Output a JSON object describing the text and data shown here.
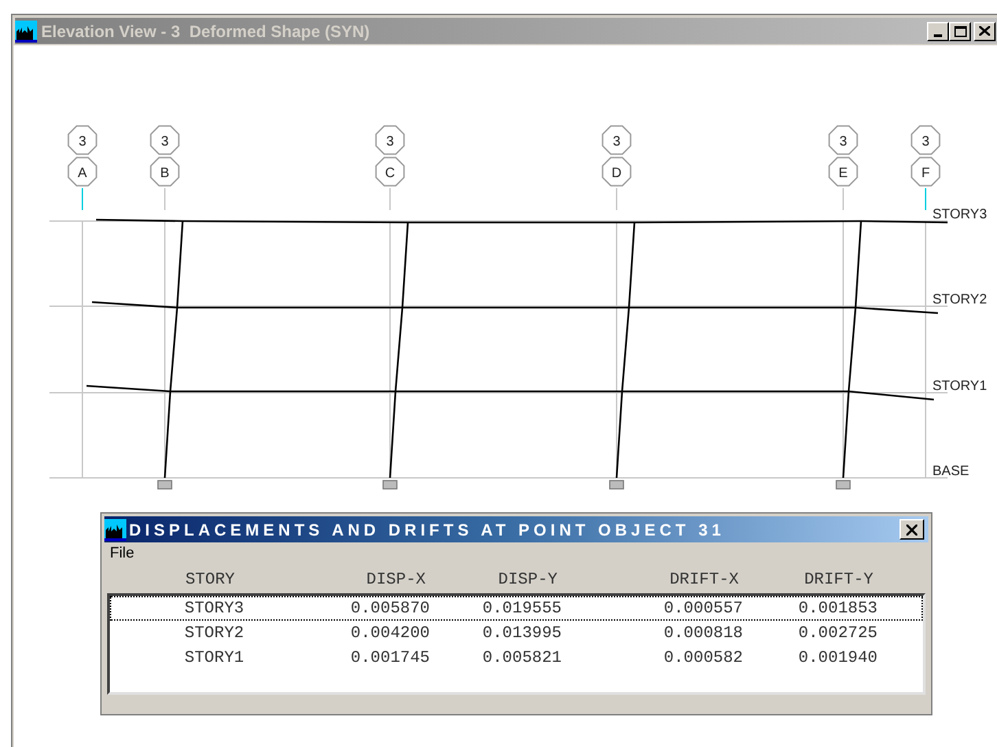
{
  "window": {
    "title": "Elevation View - 3  Deformed Shape (SYN)"
  },
  "elevation": {
    "grid_bubbles": [
      {
        "number": "3",
        "label": "A"
      },
      {
        "number": "3",
        "label": "B"
      },
      {
        "number": "3",
        "label": "C"
      },
      {
        "number": "3",
        "label": "D"
      },
      {
        "number": "3",
        "label": "E"
      },
      {
        "number": "3",
        "label": "F"
      }
    ],
    "story_levels": [
      "STORY3",
      "STORY2",
      "STORY1",
      "BASE"
    ]
  },
  "dialog": {
    "title": "DISPLACEMENTS AND DRIFTS AT POINT OBJECT 31",
    "menu": [
      "File"
    ],
    "columns": [
      "STORY",
      "DISP-X",
      "DISP-Y",
      "DRIFT-X",
      "DRIFT-Y"
    ],
    "rows": [
      {
        "cells": [
          "STORY3",
          "0.005870",
          "0.019555",
          "0.000557",
          "0.001853"
        ],
        "selected": true
      },
      {
        "cells": [
          "STORY2",
          "0.004200",
          "0.013995",
          "0.000818",
          "0.002725"
        ],
        "selected": false
      },
      {
        "cells": [
          "STORY1",
          "0.001745",
          "0.005821",
          "0.000582",
          "0.001940"
        ],
        "selected": false
      }
    ]
  }
}
